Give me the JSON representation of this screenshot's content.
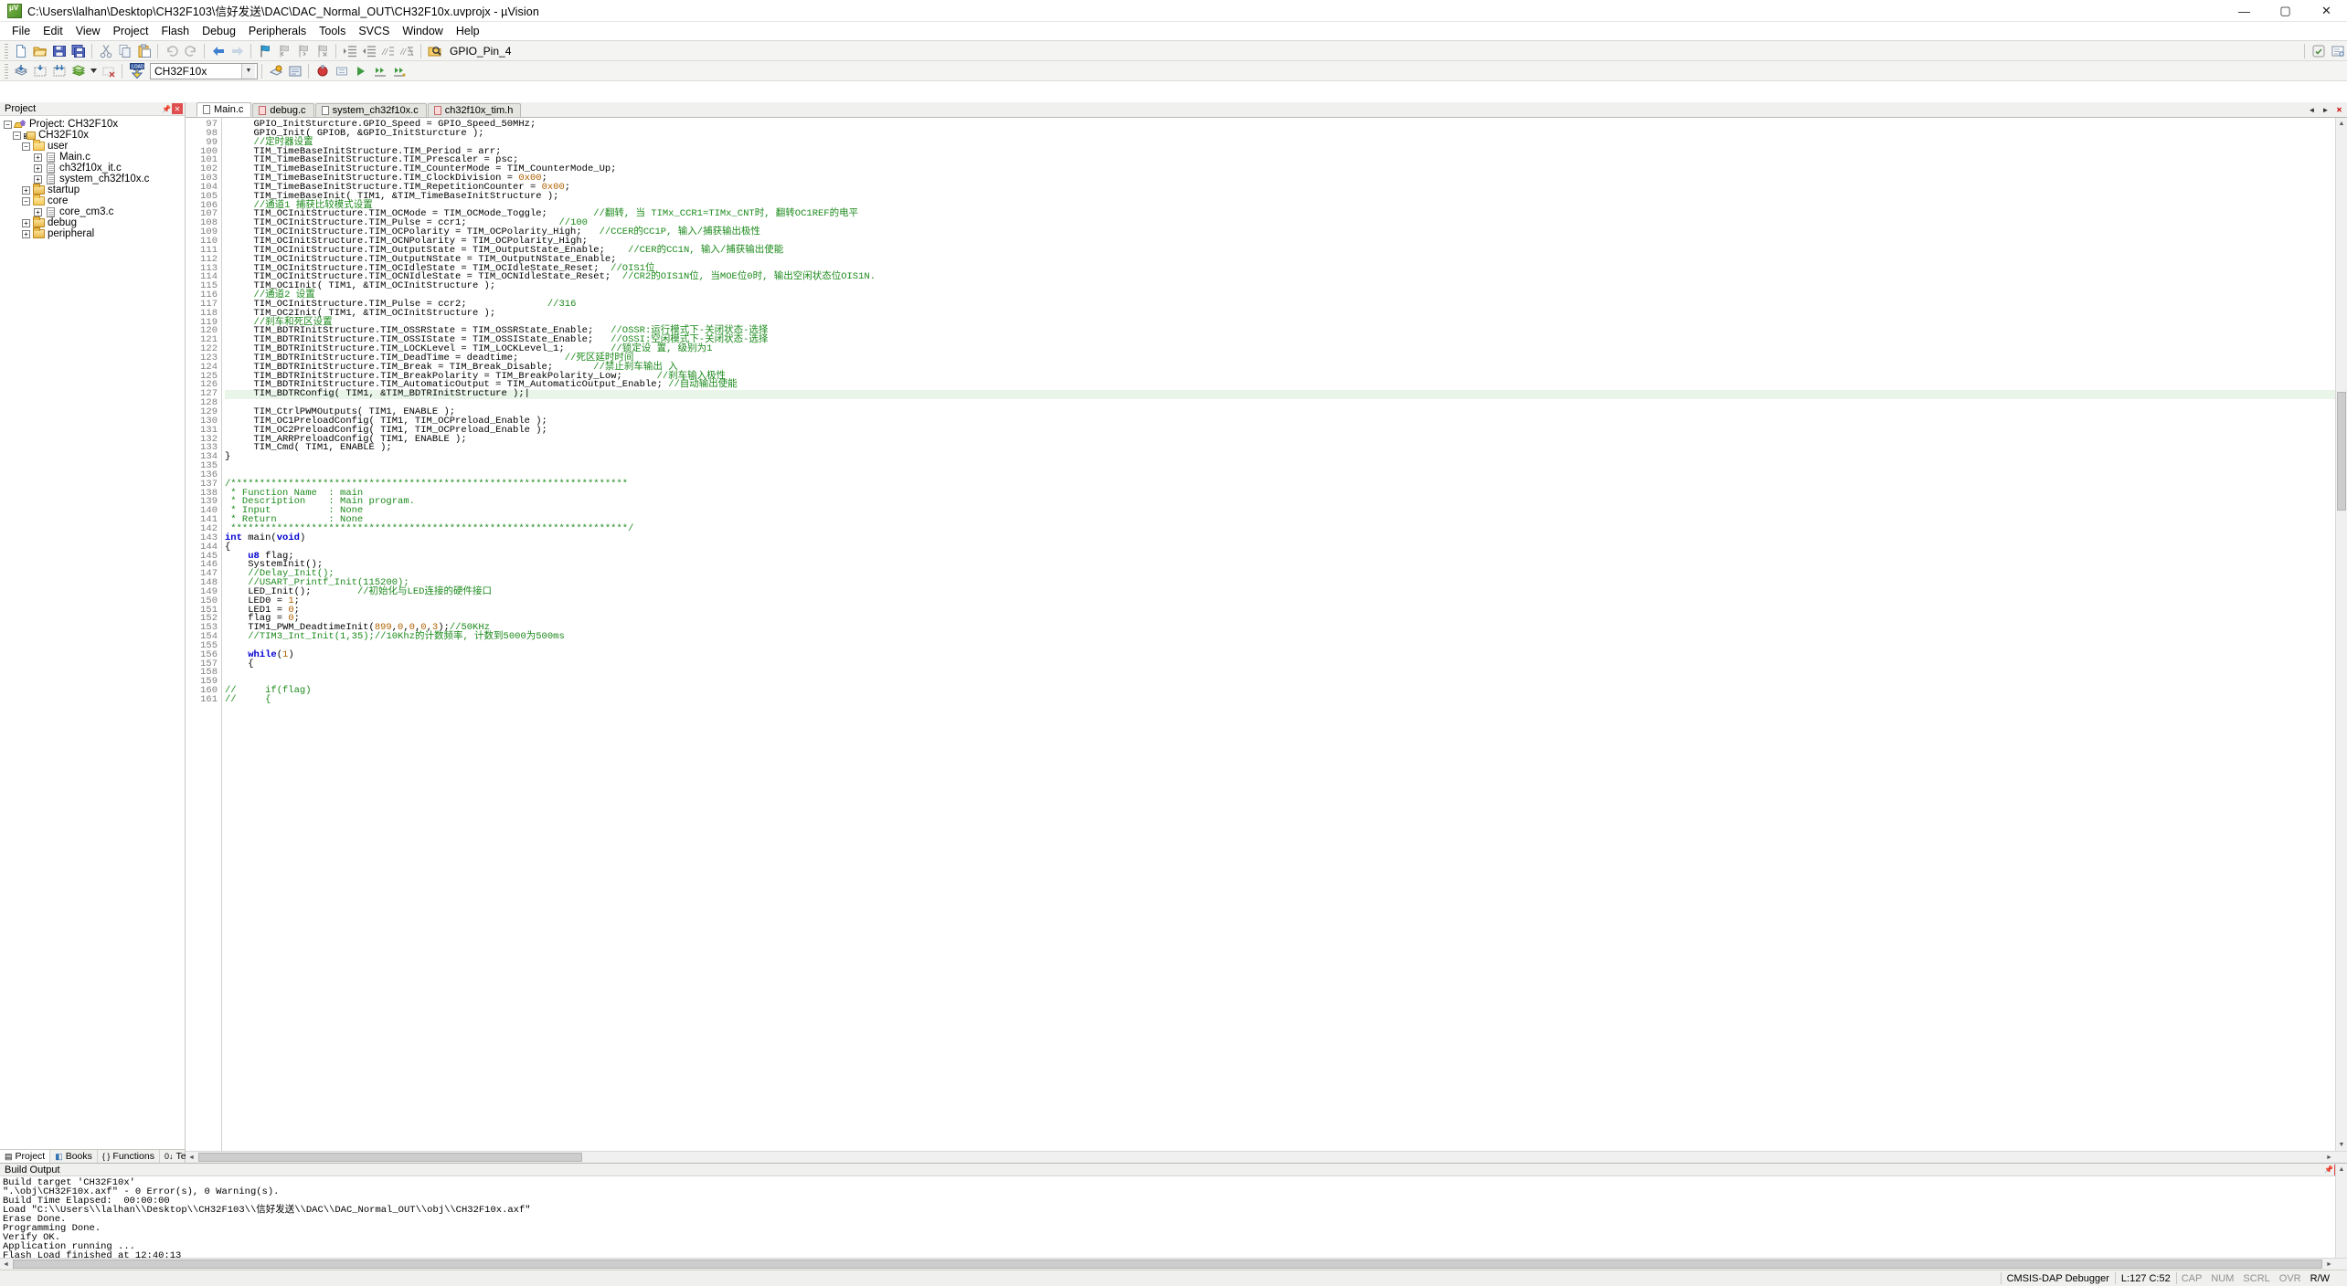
{
  "window": {
    "title": "C:\\Users\\lalhan\\Desktop\\CH32F103\\信好发送\\DAC\\DAC_Normal_OUT\\CH32F10x.uvprojx - µVision",
    "logo": "uvision-logo",
    "buttons": {
      "minimize": "—",
      "maximize": "▢",
      "close": "✕"
    }
  },
  "menubar": {
    "items": [
      "File",
      "Edit",
      "View",
      "Project",
      "Flash",
      "Debug",
      "Peripherals",
      "Tools",
      "SVCS",
      "Window",
      "Help"
    ]
  },
  "toolbar_main": {
    "icons": [
      "new-file-icon",
      "open-file-icon",
      "save-icon",
      "save-all-icon",
      "cut-icon",
      "copy-icon",
      "paste-icon",
      "undo-icon",
      "redo-icon",
      "navigate-back-icon",
      "navigate-forward-icon",
      "bookmark-toggle-icon",
      "bookmark-prev-icon",
      "bookmark-next-icon",
      "bookmark-clear-icon",
      "indent-icon",
      "outdent-icon",
      "comment-icon",
      "uncomment-icon",
      "find-in-files-icon"
    ],
    "bookmark_label": "GPIO_Pin_4",
    "right_icons": [
      "insert-include-icon",
      "configuration-wizard-icon",
      "find-icon",
      "find-dropdown-icon",
      "debug-icon",
      "debug-settings-icon",
      "window-layout-icon",
      "help-icon"
    ]
  },
  "toolbar_build": {
    "icons": [
      "translate-icon",
      "build-icon",
      "rebuild-icon",
      "batch-build-icon",
      "batch-build-dropdown-icon",
      "stop-build-icon",
      "download-icon"
    ],
    "download_label": "LOAD",
    "target_value": "CH32F10x",
    "target_caret": "▼",
    "right_icons": [
      "target-options-icon",
      "manage-runtime-icon",
      "start-debug-icon",
      "reset-icon",
      "run-icon",
      "stop-icon",
      "step-icon",
      "step-over-icon",
      "step-out-icon"
    ]
  },
  "project_pane": {
    "title": "Project",
    "header_buttons": [
      "pin-icon",
      "close-icon"
    ],
    "tree": [
      {
        "depth": 0,
        "expander": "-",
        "icon": "project-icon",
        "label": "Project: CH32F10x"
      },
      {
        "depth": 1,
        "expander": "-",
        "icon": "target-icon",
        "label": "CH32F10x"
      },
      {
        "depth": 2,
        "expander": "-",
        "icon": "folder-open-icon",
        "label": "user"
      },
      {
        "depth": 3,
        "expander": "+",
        "icon": "c-file-icon",
        "label": "Main.c"
      },
      {
        "depth": 3,
        "expander": "+",
        "icon": "c-file-icon",
        "label": "ch32f10x_it.c"
      },
      {
        "depth": 3,
        "expander": "+",
        "icon": "c-file-icon",
        "label": "system_ch32f10x.c"
      },
      {
        "depth": 2,
        "expander": "+",
        "icon": "folder-closed-icon",
        "label": "startup"
      },
      {
        "depth": 2,
        "expander": "-",
        "icon": "folder-open-icon",
        "label": "core"
      },
      {
        "depth": 3,
        "expander": "+",
        "icon": "c-file-icon",
        "label": "core_cm3.c"
      },
      {
        "depth": 2,
        "expander": "+",
        "icon": "folder-closed-icon",
        "label": "debug"
      },
      {
        "depth": 2,
        "expander": "+",
        "icon": "folder-closed-icon",
        "label": "peripheral"
      }
    ],
    "tabs": [
      {
        "label": "Project",
        "icon": "project-tab-icon",
        "active": true
      },
      {
        "label": "Books",
        "icon": "books-tab-icon",
        "active": false
      },
      {
        "label": "Functions",
        "icon": "functions-tab-icon",
        "active": false
      },
      {
        "label": "Templates",
        "icon": "templates-tab-icon",
        "active": false
      }
    ]
  },
  "editor": {
    "tabs": [
      {
        "label": "Main.c",
        "active": true,
        "modified": false
      },
      {
        "label": "debug.c",
        "active": false,
        "modified": true
      },
      {
        "label": "system_ch32f10x.c",
        "active": false,
        "modified": false
      },
      {
        "label": "ch32f10x_tim.h",
        "active": false,
        "modified": true
      }
    ],
    "tab_nav": [
      "scroll-left-icon",
      "scroll-right-icon",
      "close-tab-icon"
    ],
    "first_line_number": 97,
    "highlighted_line": 127,
    "lines": [
      "     GPIO_InitSturcture.GPIO_Speed = GPIO_Speed_50MHz;",
      "     GPIO_Init( GPIOB, &GPIO_InitSturcture );",
      "     //定时器设置",
      "     TIM_TimeBaseInitStructure.TIM_Period = arr;",
      "     TIM_TimeBaseInitStructure.TIM_Prescaler = psc;",
      "     TIM_TimeBaseInitStructure.TIM_CounterMode = TIM_CounterMode_Up;",
      "     TIM_TimeBaseInitStructure.TIM_ClockDivision = 0x00;",
      "     TIM_TimeBaseInitStructure.TIM_RepetitionCounter = 0x00;",
      "     TIM_TimeBaseInit( TIM1, &TIM_TimeBaseInitStructure );",
      "     //通道1 捕获比较模式设置",
      "     TIM_OCInitStructure.TIM_OCMode = TIM_OCMode_Toggle;        //翻转, 当 TIMx_CCR1=TIMx_CNT时, 翻转OC1REF的电平",
      "     TIM_OCInitStructure.TIM_Pulse = ccr1;                //100",
      "     TIM_OCInitStructure.TIM_OCPolarity = TIM_OCPolarity_High;   //CCER的CC1P, 输入/捕获输出极性",
      "     TIM_OCInitStructure.TIM_OCNPolarity = TIM_OCPolarity_High;",
      "     TIM_OCInitStructure.TIM_OutputState = TIM_OutputState_Enable;    //CER的CC1N, 输入/捕获输出使能",
      "     TIM_OCInitStructure.TIM_OutputNState = TIM_OutputNState_Enable;",
      "     TIM_OCInitStructure.TIM_OCIdleState = TIM_OCIdleState_Reset;  //OIS1位",
      "     TIM_OCInitStructure.TIM_OCNIdleState = TIM_OCNIdleState_Reset;  //CR2的OIS1N位, 当MOE位0时, 输出空闲状态位OIS1N.",
      "     TIM_OC1Init( TIM1, &TIM_OCInitStructure );",
      "     //通道2 设置",
      "     TIM_OCInitStructure.TIM_Pulse = ccr2;              //316",
      "     TIM_OC2Init( TIM1, &TIM_OCInitStructure );",
      "     //刹车和死区设置",
      "     TIM_BDTRInitStructure.TIM_OSSRState = TIM_OSSRState_Enable;   //OSSR:运行模式下-关闭状态-选择",
      "     TIM_BDTRInitStructure.TIM_OSSIState = TIM_OSSIState_Enable;   //OSSI:空闲模式下-关闭状态-选择",
      "     TIM_BDTRInitStructure.TIM_LOCKLevel = TIM_LOCKLevel_1;        //锁定设 置, 级别为1",
      "     TIM_BDTRInitStructure.TIM_DeadTime = deadtime;        //死区延时时间",
      "     TIM_BDTRInitStructure.TIM_Break = TIM_Break_Disable;       //禁止刹车输出 入",
      "     TIM_BDTRInitStructure.TIM_BreakPolarity = TIM_BreakPolarity_Low;      //刹车输入极性",
      "     TIM_BDTRInitStructure.TIM_AutomaticOutput = TIM_AutomaticOutput_Enable; //自动输出使能",
      "     TIM_BDTRConfig( TIM1, &TIM_BDTRInitStructure );|",
      "",
      "     TIM_CtrlPWMOutputs( TIM1, ENABLE );",
      "     TIM_OC1PreloadConfig( TIM1, TIM_OCPreload_Enable );",
      "     TIM_OC2PreloadConfig( TIM1, TIM_OCPreload_Enable );",
      "     TIM_ARRPreloadConfig( TIM1, ENABLE );",
      "     TIM_Cmd( TIM1, ENABLE );",
      "}",
      "",
      "",
      "/*********************************************************************",
      " * Function Name  : main",
      " * Description    : Main program.",
      " * Input          : None",
      " * Return         : None",
      " *********************************************************************/",
      "int main(void)",
      "{",
      "    u8 flag;",
      "    SystemInit();",
      "    //Delay_Init();",
      "    //USART_Printf_Init(115200);",
      "    LED_Init();        //初始化与LED连接的硬件接口",
      "    LED0 = 1;",
      "    LED1 = 0;",
      "    flag = 0;",
      "    TIM1_PWM_DeadtimeInit(899,0,0,0,3);//50KHz",
      "    //TIM3_Int_Init(1,35);//10Khz的计数频率, 计数到5000为500ms",
      "",
      "    while(1)",
      "    {",
      "",
      "",
      "//     if(flag)",
      "//     {"
    ]
  },
  "build_output": {
    "title": "Build Output",
    "header_buttons": [
      "pin-icon",
      "close-icon"
    ],
    "lines": [
      "Build target 'CH32F10x'",
      "\".\\obj\\CH32F10x.axf\" - 0 Error(s), 0 Warning(s).",
      "Build Time Elapsed:  00:00:00",
      "Load \"C:\\\\Users\\\\lalhan\\\\Desktop\\\\CH32F103\\\\信好发送\\\\DAC\\\\DAC_Normal_OUT\\\\obj\\\\CH32F10x.axf\"",
      "Erase Done.",
      "Programming Done.",
      "Verify OK.",
      "Application running ...",
      "Flash Load finished at 12:40:13"
    ]
  },
  "statusbar": {
    "message": "",
    "debugger": "CMSIS-DAP Debugger",
    "cursor": "L:127 C:52",
    "flags": [
      {
        "label": "CAP",
        "on": false
      },
      {
        "label": "NUM",
        "on": false
      },
      {
        "label": "SCRL",
        "on": false
      },
      {
        "label": "OVR",
        "on": false
      },
      {
        "label": "R/W",
        "on": true
      }
    ]
  },
  "colors": {
    "keyword": "#0000d0",
    "comment": "#1c8a1c",
    "number": "#b06000",
    "highlight_line": "#e9f5e9",
    "chrome": "#f0f0ee",
    "accent": "#cde0f5"
  }
}
